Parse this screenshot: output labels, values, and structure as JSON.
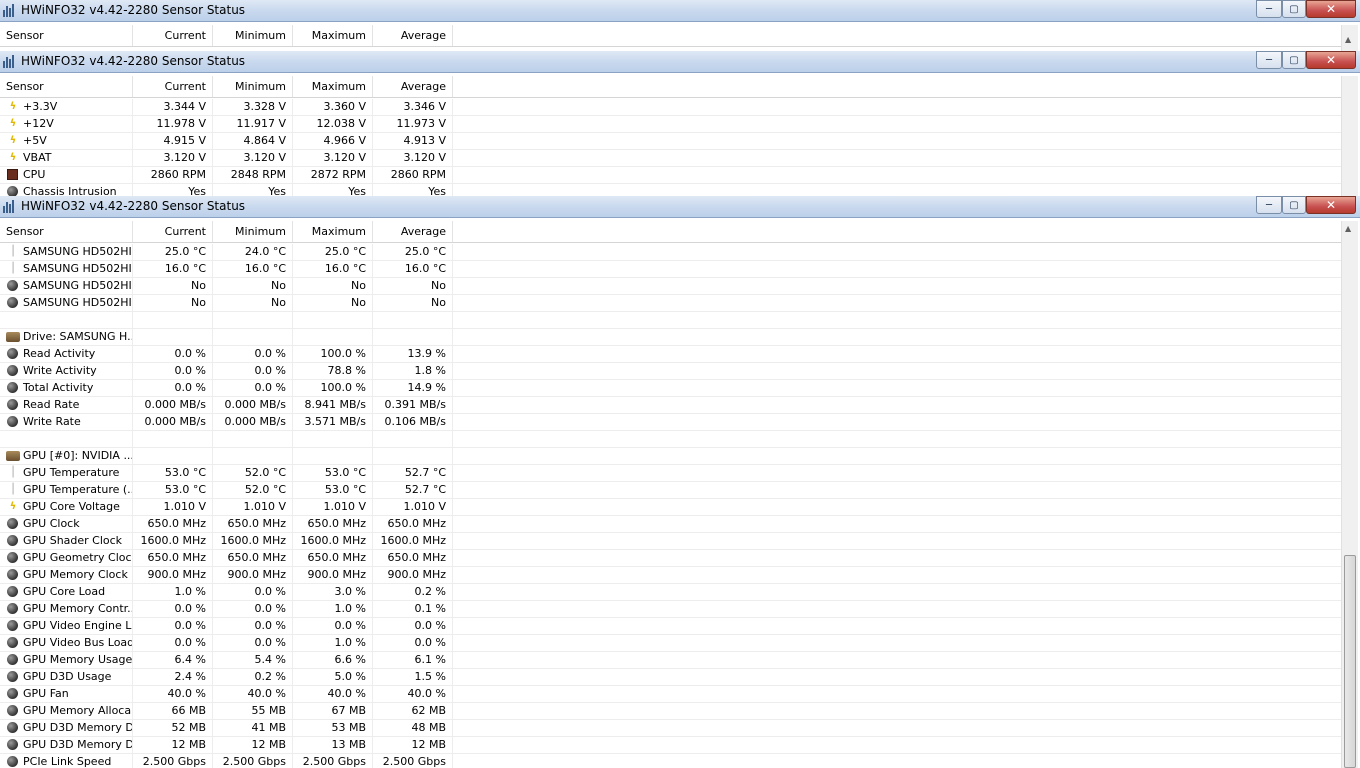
{
  "columns": {
    "sensor": "Sensor",
    "current": "Current",
    "minimum": "Minimum",
    "maximum": "Maximum",
    "average": "Average"
  },
  "controls": {
    "minimize": "─",
    "maximize": "▢",
    "close": "✕"
  },
  "windows": [
    {
      "title": "HWiNFO32 v4.42-2280 Sensor Status",
      "rows": []
    },
    {
      "title": "HWiNFO32 v4.42-2280 Sensor Status",
      "rows": [
        {
          "icon": "voltage",
          "name": "+3.3V",
          "current": "3.344 V",
          "minimum": "3.328 V",
          "maximum": "3.360 V",
          "average": "3.346 V"
        },
        {
          "icon": "voltage",
          "name": "+12V",
          "current": "11.978 V",
          "minimum": "11.917 V",
          "maximum": "12.038 V",
          "average": "11.973 V"
        },
        {
          "icon": "voltage",
          "name": "+5V",
          "current": "4.915 V",
          "minimum": "4.864 V",
          "maximum": "4.966 V",
          "average": "4.913 V"
        },
        {
          "icon": "voltage",
          "name": "VBAT",
          "current": "3.120 V",
          "minimum": "3.120 V",
          "maximum": "3.120 V",
          "average": "3.120 V"
        },
        {
          "icon": "fan",
          "name": "CPU",
          "current": "2860 RPM",
          "minimum": "2848 RPM",
          "maximum": "2872 RPM",
          "average": "2860 RPM"
        },
        {
          "icon": "other",
          "name": "Chassis Intrusion",
          "current": "Yes",
          "minimum": "Yes",
          "maximum": "Yes",
          "average": "Yes"
        }
      ]
    },
    {
      "title": "HWiNFO32 v4.42-2280 Sensor Status",
      "rows": [
        {
          "icon": "temperature",
          "name": "SAMSUNG HD502HI...",
          "current": "25.0 °C",
          "minimum": "24.0 °C",
          "maximum": "25.0 °C",
          "average": "25.0 °C"
        },
        {
          "icon": "temperature",
          "name": "SAMSUNG HD502HI...",
          "current": "16.0 °C",
          "minimum": "16.0 °C",
          "maximum": "16.0 °C",
          "average": "16.0 °C"
        },
        {
          "icon": "other",
          "name": "SAMSUNG HD502HI...",
          "current": "No",
          "minimum": "No",
          "maximum": "No",
          "average": "No"
        },
        {
          "icon": "other",
          "name": "SAMSUNG HD502HI...",
          "current": "No",
          "minimum": "No",
          "maximum": "No",
          "average": "No"
        },
        {
          "icon": "none",
          "name": "",
          "current": "",
          "minimum": "",
          "maximum": "",
          "average": ""
        },
        {
          "icon": "device",
          "name": "Drive: SAMSUNG H...",
          "current": "",
          "minimum": "",
          "maximum": "",
          "average": ""
        },
        {
          "icon": "other",
          "name": "Read Activity",
          "current": "0.0 %",
          "minimum": "0.0 %",
          "maximum": "100.0 %",
          "average": "13.9 %"
        },
        {
          "icon": "other",
          "name": "Write Activity",
          "current": "0.0 %",
          "minimum": "0.0 %",
          "maximum": "78.8 %",
          "average": "1.8 %"
        },
        {
          "icon": "other",
          "name": "Total Activity",
          "current": "0.0 %",
          "minimum": "0.0 %",
          "maximum": "100.0 %",
          "average": "14.9 %"
        },
        {
          "icon": "other",
          "name": "Read Rate",
          "current": "0.000 MB/s",
          "minimum": "0.000 MB/s",
          "maximum": "8.941 MB/s",
          "average": "0.391 MB/s"
        },
        {
          "icon": "other",
          "name": "Write Rate",
          "current": "0.000 MB/s",
          "minimum": "0.000 MB/s",
          "maximum": "3.571 MB/s",
          "average": "0.106 MB/s"
        },
        {
          "icon": "none",
          "name": "",
          "current": "",
          "minimum": "",
          "maximum": "",
          "average": ""
        },
        {
          "icon": "device",
          "name": "GPU [#0]: NVIDIA ...",
          "current": "",
          "minimum": "",
          "maximum": "",
          "average": ""
        },
        {
          "icon": "temperature",
          "name": "GPU Temperature",
          "current": "53.0 °C",
          "minimum": "52.0 °C",
          "maximum": "53.0 °C",
          "average": "52.7 °C"
        },
        {
          "icon": "temperature",
          "name": "GPU Temperature (...",
          "current": "53.0 °C",
          "minimum": "52.0 °C",
          "maximum": "53.0 °C",
          "average": "52.7 °C"
        },
        {
          "icon": "voltage",
          "name": "GPU Core Voltage",
          "current": "1.010 V",
          "minimum": "1.010 V",
          "maximum": "1.010 V",
          "average": "1.010 V"
        },
        {
          "icon": "other",
          "name": "GPU Clock",
          "current": "650.0 MHz",
          "minimum": "650.0 MHz",
          "maximum": "650.0 MHz",
          "average": "650.0 MHz"
        },
        {
          "icon": "other",
          "name": "GPU Shader Clock",
          "current": "1600.0 MHz",
          "minimum": "1600.0 MHz",
          "maximum": "1600.0 MHz",
          "average": "1600.0 MHz"
        },
        {
          "icon": "other",
          "name": "GPU Geometry Clock",
          "current": "650.0 MHz",
          "minimum": "650.0 MHz",
          "maximum": "650.0 MHz",
          "average": "650.0 MHz"
        },
        {
          "icon": "other",
          "name": "GPU Memory Clock",
          "current": "900.0 MHz",
          "minimum": "900.0 MHz",
          "maximum": "900.0 MHz",
          "average": "900.0 MHz"
        },
        {
          "icon": "other",
          "name": "GPU Core Load",
          "current": "1.0 %",
          "minimum": "0.0 %",
          "maximum": "3.0 %",
          "average": "0.2 %"
        },
        {
          "icon": "other",
          "name": "GPU Memory Contr...",
          "current": "0.0 %",
          "minimum": "0.0 %",
          "maximum": "1.0 %",
          "average": "0.1 %"
        },
        {
          "icon": "other",
          "name": "GPU Video Engine L...",
          "current": "0.0 %",
          "minimum": "0.0 %",
          "maximum": "0.0 %",
          "average": "0.0 %"
        },
        {
          "icon": "other",
          "name": "GPU Video Bus Load",
          "current": "0.0 %",
          "minimum": "0.0 %",
          "maximum": "1.0 %",
          "average": "0.0 %"
        },
        {
          "icon": "other",
          "name": "GPU Memory Usage",
          "current": "6.4 %",
          "minimum": "5.4 %",
          "maximum": "6.6 %",
          "average": "6.1 %"
        },
        {
          "icon": "other",
          "name": "GPU D3D Usage",
          "current": "2.4 %",
          "minimum": "0.2 %",
          "maximum": "5.0 %",
          "average": "1.5 %"
        },
        {
          "icon": "other",
          "name": "GPU Fan",
          "current": "40.0 %",
          "minimum": "40.0 %",
          "maximum": "40.0 %",
          "average": "40.0 %"
        },
        {
          "icon": "other",
          "name": "GPU Memory Alloca...",
          "current": "66 MB",
          "minimum": "55 MB",
          "maximum": "67 MB",
          "average": "62 MB"
        },
        {
          "icon": "other",
          "name": "GPU D3D Memory D...",
          "current": "52 MB",
          "minimum": "41 MB",
          "maximum": "53 MB",
          "average": "48 MB"
        },
        {
          "icon": "other",
          "name": "GPU D3D Memory D...",
          "current": "12 MB",
          "minimum": "12 MB",
          "maximum": "13 MB",
          "average": "12 MB"
        },
        {
          "icon": "other",
          "name": "PCIe Link Speed",
          "current": "2.500 Gbps",
          "minimum": "2.500 Gbps",
          "maximum": "2.500 Gbps",
          "average": "2.500 Gbps"
        }
      ]
    }
  ]
}
